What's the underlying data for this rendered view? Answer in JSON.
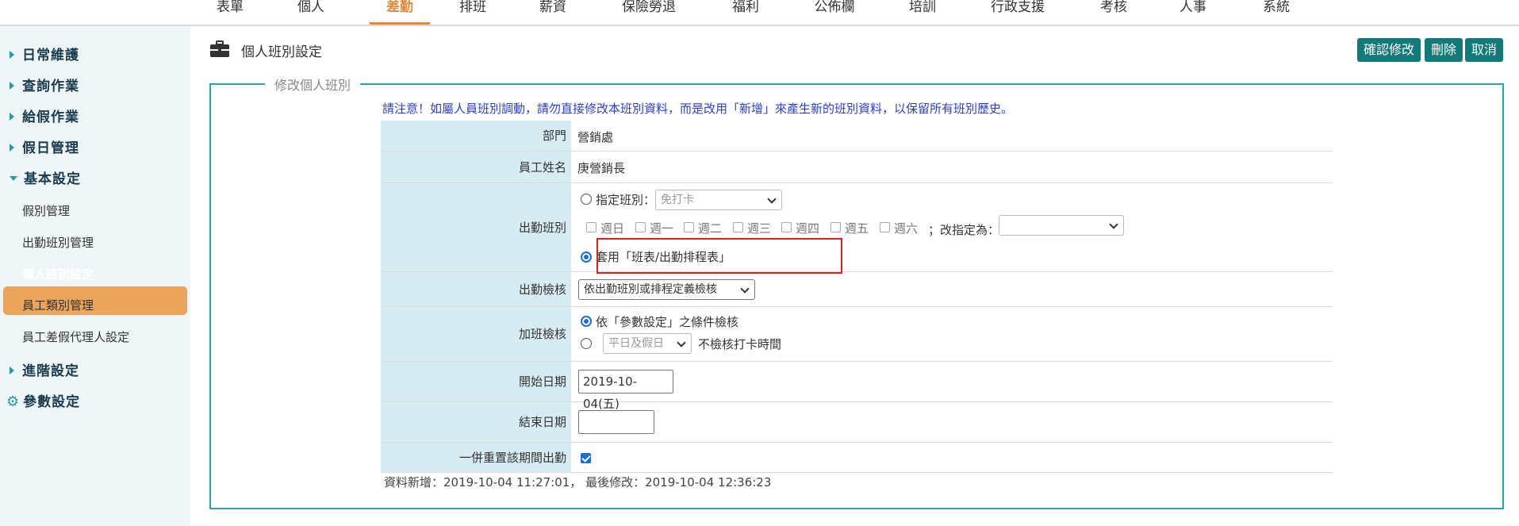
{
  "topnav": {
    "tabs": [
      {
        "label": "表單"
      },
      {
        "label": "個人"
      },
      {
        "label": "差勤",
        "active": true
      },
      {
        "label": "排班"
      },
      {
        "label": "薪資"
      },
      {
        "label": "保險勞退"
      },
      {
        "label": "福利"
      },
      {
        "label": "公佈欄"
      },
      {
        "label": "培訓"
      },
      {
        "label": "行政支援"
      },
      {
        "label": "考核"
      },
      {
        "label": "人事"
      },
      {
        "label": "系統"
      }
    ]
  },
  "sidebar": {
    "items": [
      {
        "label": "日常維護"
      },
      {
        "label": "查詢作業"
      },
      {
        "label": "給假作業"
      },
      {
        "label": "假日管理"
      },
      {
        "label": "基本設定"
      },
      {
        "label": "假別管理"
      },
      {
        "label": "出勤班別管理"
      },
      {
        "label": "個人班別設定"
      },
      {
        "label": "員工類別管理"
      },
      {
        "label": "員工差假代理人設定"
      },
      {
        "label": "進階設定"
      },
      {
        "label": "參數設定"
      }
    ]
  },
  "header": {
    "title": "個人班別設定",
    "buttons": {
      "confirm": "確認修改",
      "delete": "刪除",
      "cancel": "取消"
    }
  },
  "form": {
    "legend": "修改個人班別",
    "notice": "請注意！如屬人員班別調動，請勿直接修改本班別資料，而是改用「新增」來產生新的班別資料，以保留所有班別歷史。",
    "department": {
      "label": "部門",
      "value": "營銷處"
    },
    "employee": {
      "label": "員工姓名",
      "value": "庚營銷長"
    },
    "shift": {
      "label": "出勤班別",
      "assign_label": "指定班別：",
      "assign_select": "免打卡",
      "weekdays": [
        "週日",
        "週一",
        "週二",
        "週三",
        "週四",
        "週五",
        "週六"
      ],
      "change_label": "；改指定為：",
      "change_select": "",
      "apply_label": "套用「班表/出勤排程表」"
    },
    "check": {
      "label": "出勤檢核",
      "select": "依出勤班別或排程定義檢核"
    },
    "overtime": {
      "label": "加班檢核",
      "option1": "依「參數設定」之條件檢核",
      "option2_select": "平日及假日",
      "option2_text": "不檢核打卡時間"
    },
    "start_date": {
      "label": "開始日期",
      "value": "2019-10-04(五)"
    },
    "end_date": {
      "label": "結束日期",
      "value": ""
    },
    "reset": {
      "label": "一併重置該期間出勤",
      "checked": true
    },
    "meta": "資料新增：2019-10-04 11:27:01， 最後修改：2019-10-04 12:36:23"
  },
  "colors": {
    "accent": "#e8893a",
    "teal": "#127a78",
    "border": "#27a5b3",
    "label_bg": "#d6ebf2",
    "notice": "#2b3fd6",
    "highlight": "#e02020"
  }
}
